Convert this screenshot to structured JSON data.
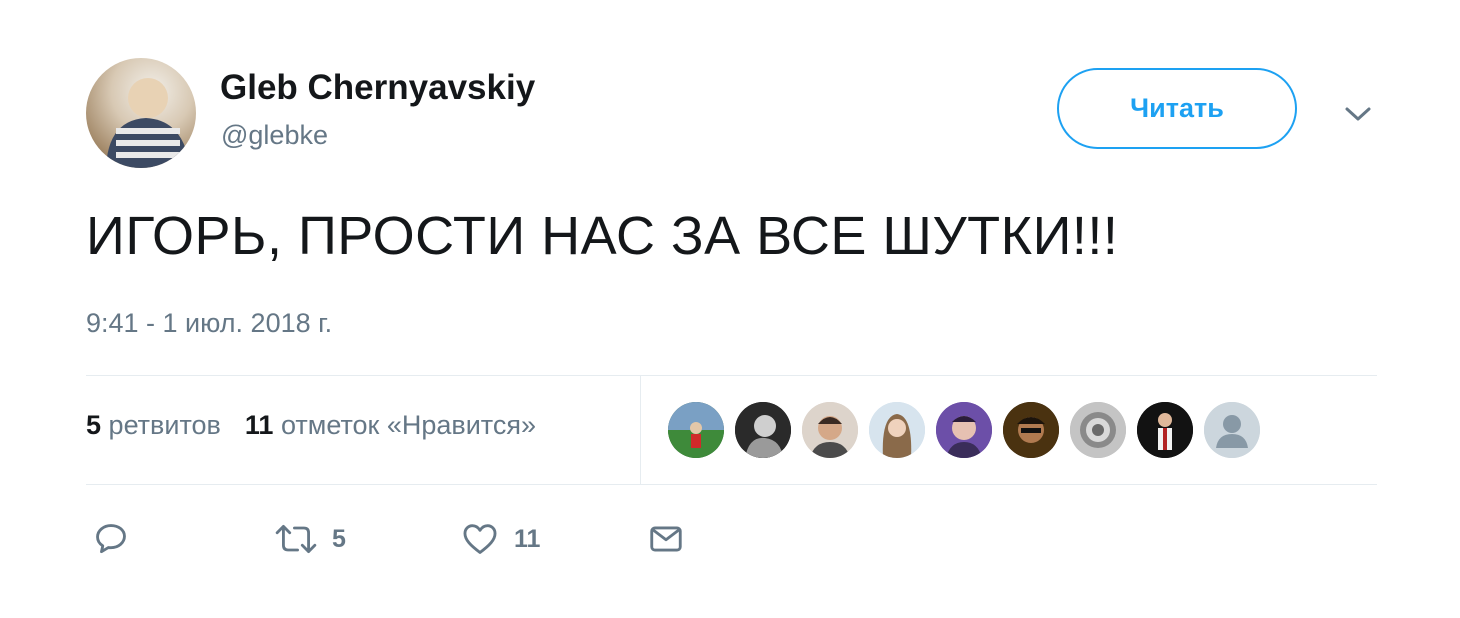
{
  "author": {
    "name": "Gleb Chernyavskiy",
    "handle": "@glebke"
  },
  "follow_button": {
    "label": "Читать",
    "color": "#1da1f2"
  },
  "tweet": {
    "text": "ИГОРЬ, ПРОСТИ НАС ЗА ВСЕ ШУТКИ!!!",
    "timestamp": "9:41 - 1 июл. 2018 г."
  },
  "stats": {
    "retweets_count": "5",
    "retweets_label": "ретвитов",
    "likes_count": "11",
    "likes_label": "отметок «Нравится»"
  },
  "likers": [
    {
      "name": "liker-1"
    },
    {
      "name": "liker-2"
    },
    {
      "name": "liker-3"
    },
    {
      "name": "liker-4"
    },
    {
      "name": "liker-5"
    },
    {
      "name": "liker-6"
    },
    {
      "name": "liker-7"
    },
    {
      "name": "liker-8"
    },
    {
      "name": "liker-9"
    }
  ],
  "actions": {
    "reply_icon": "reply-icon",
    "retweet_icon": "retweet-icon",
    "retweet_count": "5",
    "like_icon": "heart-icon",
    "like_count": "11",
    "dm_icon": "envelope-icon"
  },
  "colors": {
    "text": "#14171a",
    "secondary": "#657786",
    "divider": "#e6ecf0",
    "accent": "#1da1f2"
  }
}
